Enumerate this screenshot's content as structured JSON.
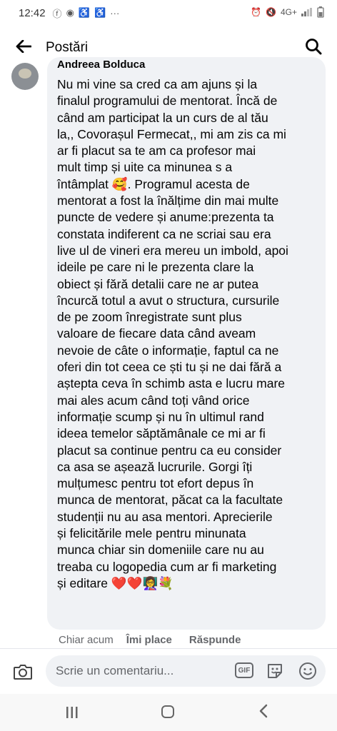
{
  "status_bar": {
    "time": "12:42",
    "left_icons": [
      "facebook-icon",
      "messenger-icon",
      "accessibility-icon",
      "accessibility-icon",
      "more-icon"
    ],
    "network": "4G+"
  },
  "header": {
    "title": "Postări"
  },
  "comment": {
    "author": "Andreea Bolduca",
    "text": "Nu mi vine sa cred ca am ajuns și la\nfinalul programului de mentorat. Încă de\ncând am participat la un curs de al tău\nla,, Covorașul Fermecat,, mi am zis ca mi\nar fi placut sa te am ca profesor mai\nmult timp și uite ca minunea s a\nîntâmplat 🥰. Programul acesta de\nmentorat a fost la înălțime  din mai multe\npuncte de vedere și anume:prezenta ta\nconstata indiferent ca ne scriai sau era\nlive ul de vineri era mereu un imbold, apoi\nideile pe care ni le prezenta clare la\nobiect și fără detalii care ne ar putea\nîncurcă totul a avut o structura, cursurile\nde pe zoom înregistrate sunt plus\nvaloare de fiecare data când aveam\nnevoie de câte o informație, faptul ca ne\noferi din tot ceea ce ști tu și ne dai fără a\naștepta ceva în schimb asta e lucru mare\nmai ales acum când toți vând orice\ninformație scump și nu în ultimul rand\nideea temelor săptămânale ce mi ar fi\nplacut sa continue pentru ca eu consider\nca asa se așează lucrurile. Gorgi îți\nmulțumesc pentru tot efort depus în\nmunca de mentorat, păcat ca la facultate\nstudenții nu au asa mentori. Aprecierile\nși felicitările mele pentru minunata\nmunca chiar sin domeniile care nu au\ntreaba cu logopedia cum ar fi marketing\nși editare ❤️❤️👩‍🏫💐",
    "time": "Chiar acum",
    "like_label": "Îmi place",
    "reply_label": "Răspunde"
  },
  "composer": {
    "placeholder": "Scrie un comentariu...",
    "gif_label": "GIF"
  },
  "colors": {
    "bubble": "#f0f2f5",
    "secondary_text": "#65676b",
    "heart": "#e41e3f"
  }
}
